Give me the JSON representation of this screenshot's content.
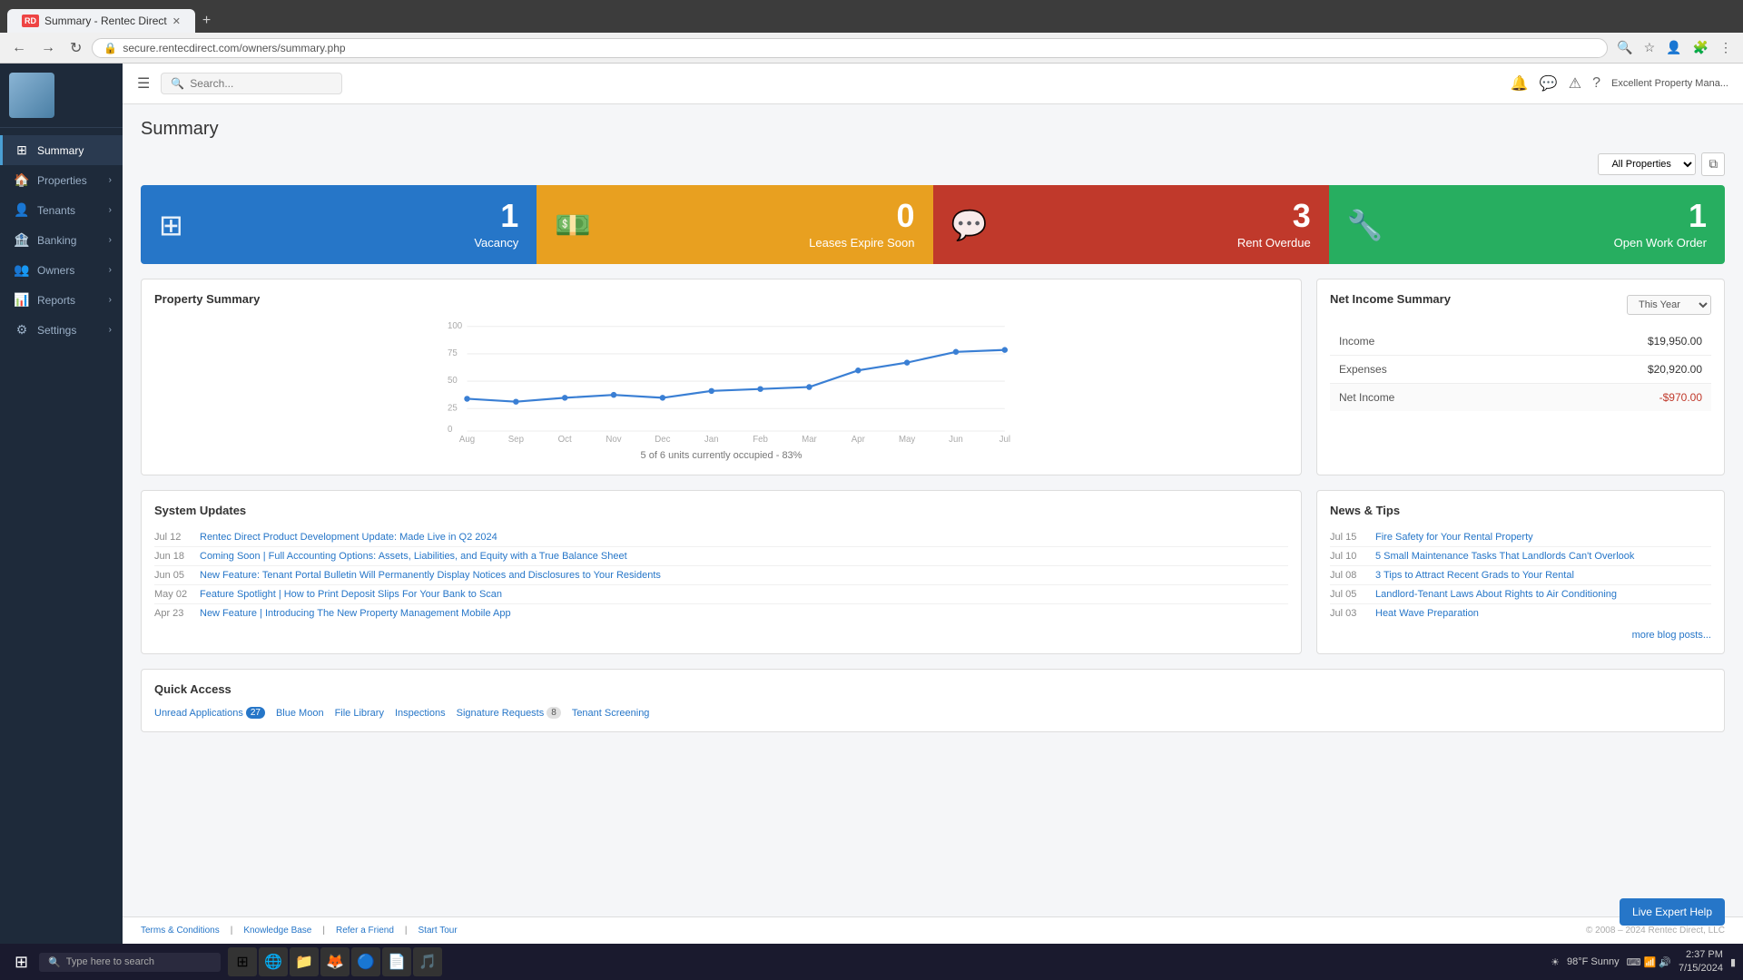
{
  "browser": {
    "tab_title": "Summary - Rentec Direct",
    "tab_favicon": "RD",
    "address": "secure.rentecdirect.com/owners/summary.php",
    "new_tab_label": "+"
  },
  "topbar": {
    "search_placeholder": "Search...",
    "user_label": "Excellent Property Mana..."
  },
  "sidebar": {
    "items": [
      {
        "id": "summary",
        "label": "Summary",
        "icon": "⊞",
        "active": true
      },
      {
        "id": "properties",
        "label": "Properties",
        "icon": "🏠",
        "has_children": true
      },
      {
        "id": "tenants",
        "label": "Tenants",
        "icon": "👤",
        "has_children": true
      },
      {
        "id": "banking",
        "label": "Banking",
        "icon": "🏦",
        "has_children": true
      },
      {
        "id": "owners",
        "label": "Owners",
        "icon": "👥",
        "has_children": true
      },
      {
        "id": "reports",
        "label": "Reports",
        "icon": "📊",
        "has_children": true
      },
      {
        "id": "settings",
        "label": "Settings",
        "icon": "⚙",
        "has_children": true
      }
    ]
  },
  "page": {
    "title": "Summary"
  },
  "summary_cards": [
    {
      "id": "vacancy",
      "number": "1",
      "label": "Vacancy",
      "color": "vacancy",
      "icon": "⊞"
    },
    {
      "id": "leases",
      "number": "0",
      "label": "Leases Expire Soon",
      "color": "leases",
      "icon": "💵"
    },
    {
      "id": "rent_overdue",
      "number": "3",
      "label": "Rent Overdue",
      "color": "rent-overdue",
      "icon": "💬"
    },
    {
      "id": "work_order",
      "number": "1",
      "label": "Open Work Order",
      "color": "work-order",
      "icon": "🔧"
    }
  ],
  "filter": {
    "all_properties": "All Properties",
    "filter_icon": "▼"
  },
  "property_summary": {
    "title": "Property Summary",
    "caption": "5 of 6 units currently occupied - 83%",
    "chart": {
      "labels": [
        "Aug",
        "Sep",
        "Oct",
        "Nov",
        "Dec",
        "Jan",
        "Feb",
        "Mar",
        "Apr",
        "May",
        "Jun",
        "Jul"
      ],
      "values": [
        30,
        28,
        32,
        35,
        32,
        38,
        40,
        42,
        58,
        65,
        75,
        77
      ],
      "y_labels": [
        "100",
        "75",
        "50",
        "25",
        "0"
      ]
    }
  },
  "net_income": {
    "title": "Net Income Summary",
    "period": "This Year",
    "rows": [
      {
        "label": "Income",
        "value": "$19,950.00",
        "negative": false
      },
      {
        "label": "Expenses",
        "value": "$20,920.00",
        "negative": false
      },
      {
        "label": "Net Income",
        "value": "-$970.00",
        "negative": true
      }
    ]
  },
  "system_updates": {
    "title": "System Updates",
    "items": [
      {
        "date": "Jul 12",
        "text": "Rentec Direct Product Development Update: Made Live in Q2 2024"
      },
      {
        "date": "Jun 18",
        "text": "Coming Soon | Full Accounting Options: Assets, Liabilities, and Equity with a True Balance Sheet"
      },
      {
        "date": "Jun 05",
        "text": "New Feature: Tenant Portal Bulletin Will Permanently Display Notices and Disclosures to Your Residents"
      },
      {
        "date": "May 02",
        "text": "Feature Spotlight | How to Print Deposit Slips For Your Bank to Scan"
      },
      {
        "date": "Apr 23",
        "text": "New Feature | Introducing The New Property Management Mobile App"
      }
    ]
  },
  "news_tips": {
    "title": "News & Tips",
    "items": [
      {
        "date": "Jul 15",
        "text": "Fire Safety for Your Rental Property"
      },
      {
        "date": "Jul 10",
        "text": "5 Small Maintenance Tasks That Landlords Can't Overlook"
      },
      {
        "date": "Jul 08",
        "text": "3 Tips to Attract Recent Grads to Your Rental"
      },
      {
        "date": "Jul 05",
        "text": "Landlord-Tenant Laws About Rights to Air Conditioning"
      },
      {
        "date": "Jul 03",
        "text": "Heat Wave Preparation"
      }
    ],
    "more_label": "more blog posts..."
  },
  "quick_access": {
    "title": "Quick Access",
    "links": [
      {
        "label": "Unread Applications",
        "badge": "27",
        "highlight": true
      },
      {
        "label": "Blue Moon",
        "badge": null
      },
      {
        "label": "File Library",
        "badge": null
      },
      {
        "label": "Inspections",
        "badge": null
      },
      {
        "label": "Signature Requests",
        "badge": "8",
        "highlight": false
      },
      {
        "label": "Tenant Screening",
        "badge": null
      }
    ]
  },
  "footer": {
    "links": [
      "Terms & Conditions",
      "Knowledge Base",
      "Refer a Friend",
      "Start Tour"
    ],
    "copyright": "© 2008 – 2024 Rentec Direct, LLC",
    "live_help": "Live Expert Help"
  },
  "taskbar": {
    "search_placeholder": "Type here to search",
    "time": "2:37 PM",
    "date": "7/15/2024",
    "weather": "98°F  Sunny"
  }
}
